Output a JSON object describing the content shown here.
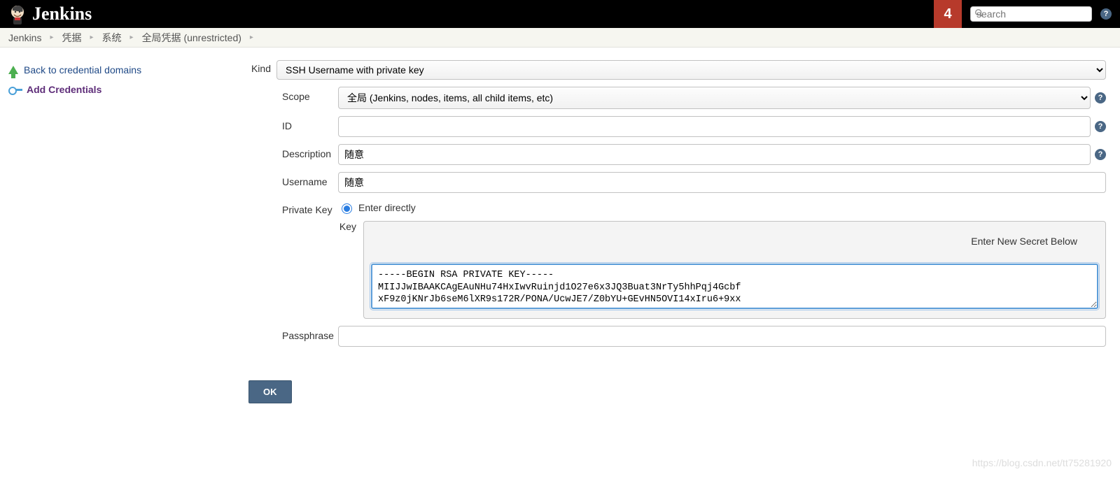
{
  "header": {
    "product_name": "Jenkins",
    "alert_count": "4",
    "search_placeholder": "search"
  },
  "breadcrumbs": {
    "items": [
      "Jenkins",
      "凭据",
      "系统",
      "全局凭据 (unrestricted)"
    ]
  },
  "sidebar": {
    "back_label": "Back to credential domains",
    "add_label": "Add Credentials"
  },
  "form": {
    "kind_label": "Kind",
    "kind_value": "SSH Username with private key",
    "scope_label": "Scope",
    "scope_value": "全局 (Jenkins, nodes, items, all child items, etc)",
    "id_label": "ID",
    "id_value": "",
    "description_label": "Description",
    "description_value": "随意",
    "username_label": "Username",
    "username_value": "随意",
    "private_key_label": "Private Key",
    "enter_directly_label": "Enter directly",
    "key_label": "Key",
    "enter_secret_below": "Enter New Secret Below",
    "secret_value": "-----BEGIN RSA PRIVATE KEY-----\nMIIJJwIBAAKCAgEAuNHu74HxIwvRuinjd1O27e6x3JQ3Buat3NrTy5hhPqj4Gcbf\nxF9z0jKNrJb6seM6lXR9s172R/PONA/UcwJE7/Z0bYU+GEvHN5OVI14xIru6+9xx",
    "passphrase_label": "Passphrase",
    "passphrase_value": "",
    "ok_label": "OK"
  },
  "watermark": "https://blog.csdn.net/tt75281920"
}
